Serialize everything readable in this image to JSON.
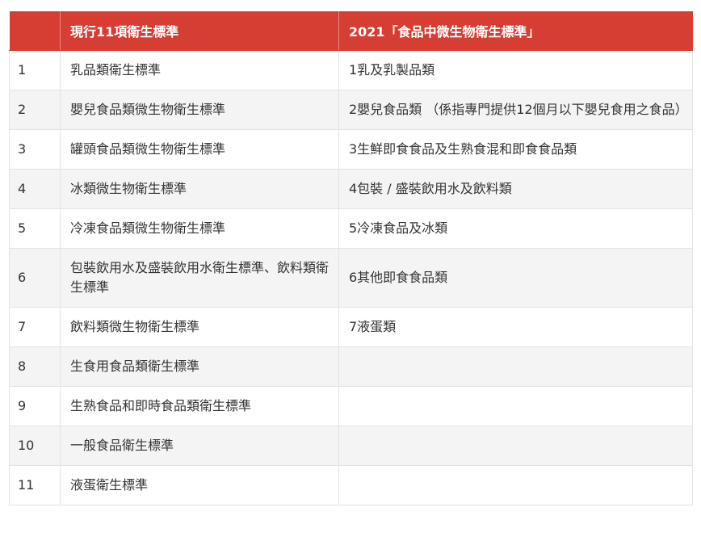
{
  "table": {
    "headers": [
      "",
      "現行11項衛生標準",
      "2021「食品中微生物衛生標準」"
    ],
    "rows": [
      [
        "1",
        "乳品類衛生標準",
        "1乳及乳製品類"
      ],
      [
        "2",
        "嬰兒食品類微生物衛生標準",
        "2嬰兒食品類 （係指專門提供12個月以下嬰兒食用之食品）"
      ],
      [
        "3",
        "罐頭食品類微生物衛生標準",
        "3生鮮即食食品及生熟食混和即食食品類"
      ],
      [
        "4",
        "冰類微生物衛生標準",
        "4包裝 / 盛裝飲用水及飲料類"
      ],
      [
        "5",
        "冷凍食品類微生物衛生標準",
        "5冷凍食品及冰類"
      ],
      [
        "6",
        "包裝飲用水及盛裝飲用水衛生標準、飲料類衛生標準",
        "6其他即食食品類"
      ],
      [
        "7",
        "飲料類微生物衛生標準",
        "7液蛋類"
      ],
      [
        "8",
        "生食用食品類衛生標準",
        ""
      ],
      [
        "9",
        "生熟食品和即時食品類衛生標準",
        ""
      ],
      [
        "10",
        "一般食品衛生標準",
        ""
      ],
      [
        "11",
        "液蛋衛生標準",
        ""
      ]
    ]
  },
  "colors": {
    "header_bg": "#d63d33",
    "header_text": "#ffffff",
    "stripe_bg": "#f4f4f4",
    "border": "#e3e3e3",
    "text": "#333333"
  }
}
